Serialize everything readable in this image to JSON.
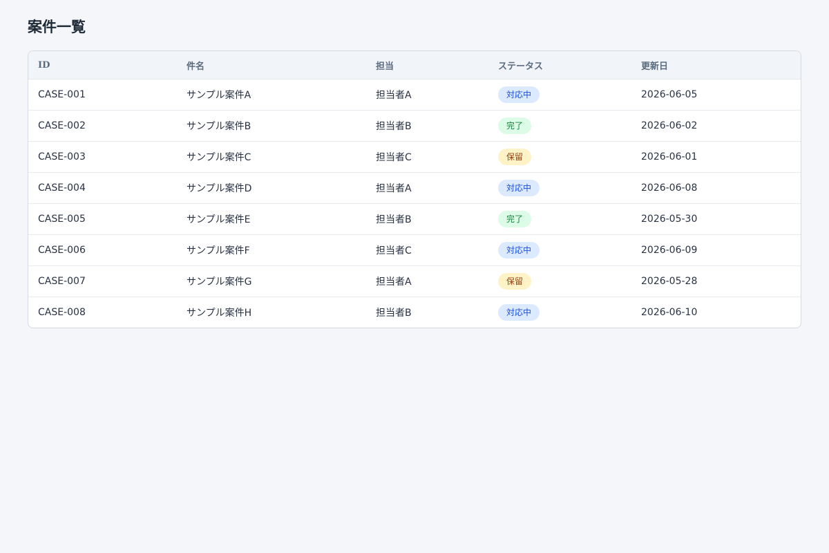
{
  "page": {
    "title": "案件一覧"
  },
  "table": {
    "columns": [
      "ID",
      "件名",
      "担当",
      "ステータス",
      "更新日"
    ],
    "rows": [
      {
        "id": "CASE-001",
        "name": "サンプル案件A",
        "owner": "担当者A",
        "status": "対応中",
        "status_type": "in-progress",
        "updated": "2026-06-05"
      },
      {
        "id": "CASE-002",
        "name": "サンプル案件B",
        "owner": "担当者B",
        "status": "完了",
        "status_type": "done",
        "updated": "2026-06-02"
      },
      {
        "id": "CASE-003",
        "name": "サンプル案件C",
        "owner": "担当者C",
        "status": "保留",
        "status_type": "hold",
        "updated": "2026-06-01"
      },
      {
        "id": "CASE-004",
        "name": "サンプル案件D",
        "owner": "担当者A",
        "status": "対応中",
        "status_type": "in-progress",
        "updated": "2026-06-08"
      },
      {
        "id": "CASE-005",
        "name": "サンプル案件E",
        "owner": "担当者B",
        "status": "完了",
        "status_type": "done",
        "updated": "2026-05-30"
      },
      {
        "id": "CASE-006",
        "name": "サンプル案件F",
        "owner": "担当者C",
        "status": "対応中",
        "status_type": "in-progress",
        "updated": "2026-06-09"
      },
      {
        "id": "CASE-007",
        "name": "サンプル案件G",
        "owner": "担当者A",
        "status": "保留",
        "status_type": "hold",
        "updated": "2026-05-28"
      },
      {
        "id": "CASE-008",
        "name": "サンプル案件H",
        "owner": "担当者B",
        "status": "対応中",
        "status_type": "in-progress",
        "updated": "2026-06-10"
      }
    ]
  },
  "colors": {
    "background": "#f4f6f9",
    "status_in_progress": "#dbeafe",
    "status_done": "#dcfce7",
    "status_hold": "#fef3c7"
  }
}
